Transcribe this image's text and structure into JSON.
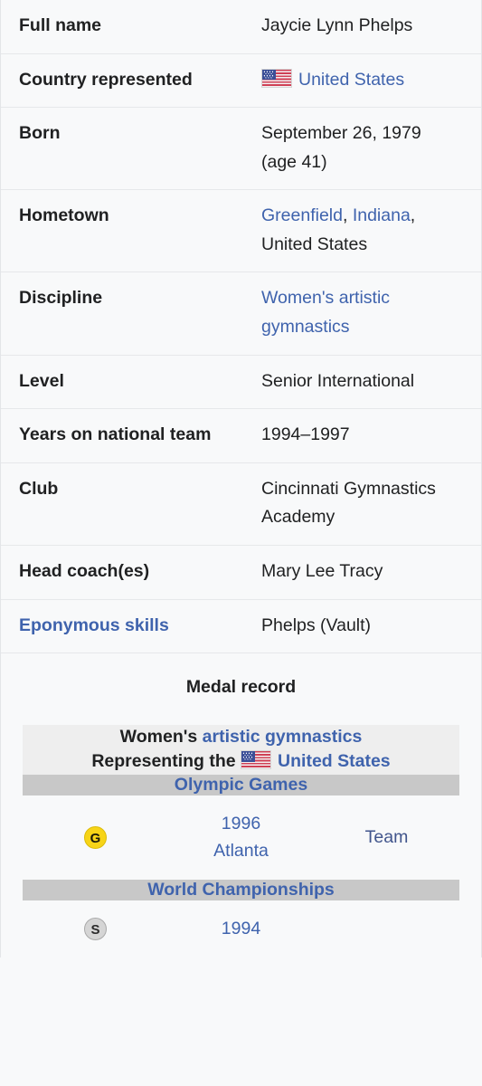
{
  "colors": {
    "link": "#3f63ad",
    "text": "#202122",
    "infobox_bg": "#f8f9fa",
    "medal_header_bg": "#eeeeee",
    "medal_event_bg": "#c8c8c8",
    "gold": "#f7d417",
    "silver": "#d5d5d5"
  },
  "infobox": {
    "rows": [
      {
        "label": "Full name",
        "label_is_link": false,
        "value_lines": [
          {
            "parts": [
              {
                "text": "Jaycie Lynn Phelps",
                "link": false
              }
            ]
          }
        ]
      },
      {
        "label": "Country represented",
        "label_is_link": false,
        "flag": "us-flag-icon",
        "value_lines": [
          {
            "parts": [
              {
                "text": "United States",
                "link": true
              }
            ]
          }
        ]
      },
      {
        "label": "Born",
        "label_is_link": false,
        "value_lines": [
          {
            "parts": [
              {
                "text": "September 26, 1979",
                "link": false
              }
            ]
          },
          {
            "parts": [
              {
                "text": "(age 41)",
                "link": false
              }
            ]
          }
        ]
      },
      {
        "label": "Hometown",
        "label_is_link": false,
        "value_lines": [
          {
            "parts": [
              {
                "text": "Greenfield",
                "link": true
              },
              {
                "text": ", ",
                "link": false
              },
              {
                "text": "Indiana",
                "link": true
              },
              {
                "text": ",",
                "link": false
              }
            ]
          },
          {
            "parts": [
              {
                "text": "United States",
                "link": false
              }
            ]
          }
        ]
      },
      {
        "label": "Discipline",
        "label_is_link": false,
        "value_lines": [
          {
            "parts": [
              {
                "text": "Women's artistic gymnastics",
                "link": true
              }
            ]
          }
        ]
      },
      {
        "label": "Level",
        "label_is_link": false,
        "value_lines": [
          {
            "parts": [
              {
                "text": "Senior International",
                "link": false
              }
            ]
          }
        ]
      },
      {
        "label": "Years on national team",
        "label_is_link": false,
        "value_lines": [
          {
            "parts": [
              {
                "text": "1994–1997",
                "link": false
              }
            ]
          }
        ]
      },
      {
        "label": "Club",
        "label_is_link": false,
        "value_lines": [
          {
            "parts": [
              {
                "text": "Cincinnati Gymnastics",
                "link": false
              }
            ]
          },
          {
            "parts": [
              {
                "text": "Academy",
                "link": false
              }
            ]
          }
        ]
      },
      {
        "label": "Head coach(es)",
        "label_is_link": false,
        "value_lines": [
          {
            "parts": [
              {
                "text": "Mary Lee Tracy",
                "link": false
              }
            ]
          }
        ]
      },
      {
        "label": "Eponymous skills",
        "label_is_link": true,
        "value_lines": [
          {
            "parts": [
              {
                "text": "Phelps (Vault)",
                "link": false
              }
            ]
          }
        ]
      }
    ]
  },
  "medal_record": {
    "title": "Medal record",
    "discipline_prefix": "Women's",
    "discipline_link": "artistic gymnastics",
    "representing_prefix": "Representing the",
    "representing_flag": "us-flag-icon",
    "representing_country": "United States",
    "sections": [
      {
        "event_name": "Olympic Games",
        "entries": [
          {
            "medal": "Gold",
            "medal_letter": "G",
            "medal_class": "gold",
            "games_lines": [
              "1996",
              "Atlanta"
            ],
            "event": "Team"
          }
        ]
      },
      {
        "event_name": "World Championships",
        "entries": [
          {
            "medal": "Silver",
            "medal_letter": "S",
            "medal_class": "silver",
            "games_lines": [
              "1994"
            ],
            "event": ""
          }
        ]
      }
    ]
  }
}
